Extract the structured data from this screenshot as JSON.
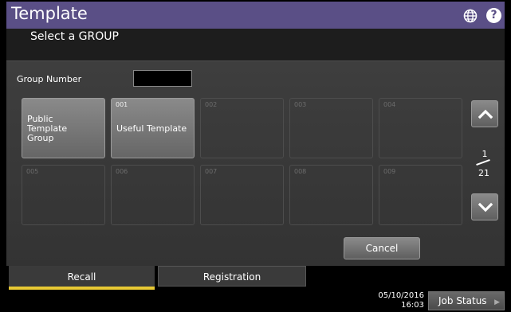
{
  "header": {
    "title": "Template",
    "globe_icon": "globe-icon",
    "help_icon": "?",
    "accent_color": "#5a4f86"
  },
  "subheader": {
    "subtitle": "Select a GROUP"
  },
  "group_number": {
    "label": "Group Number",
    "value": ""
  },
  "tiles": [
    {
      "number": "",
      "name_lines": [
        "Public",
        "Template",
        "Group"
      ],
      "active": true
    },
    {
      "number": "001",
      "name_lines": [
        "Useful Template"
      ],
      "active": true
    },
    {
      "number": "002",
      "name_lines": [],
      "active": false
    },
    {
      "number": "003",
      "name_lines": [],
      "active": false
    },
    {
      "number": "004",
      "name_lines": [],
      "active": false
    },
    {
      "number": "005",
      "name_lines": [],
      "active": false
    },
    {
      "number": "006",
      "name_lines": [],
      "active": false
    },
    {
      "number": "007",
      "name_lines": [],
      "active": false
    },
    {
      "number": "008",
      "name_lines": [],
      "active": false
    },
    {
      "number": "009",
      "name_lines": [],
      "active": false
    }
  ],
  "pagination": {
    "current": "1",
    "total": "21",
    "up_icon": "chevron-up-icon",
    "down_icon": "chevron-down-icon"
  },
  "actions": {
    "cancel_label": "Cancel"
  },
  "tabs": [
    {
      "label": "Recall",
      "selected": true
    },
    {
      "label": "Registration",
      "selected": false
    }
  ],
  "footer": {
    "date": "05/10/2016",
    "time": "16:03",
    "job_status_label": "Job Status"
  }
}
